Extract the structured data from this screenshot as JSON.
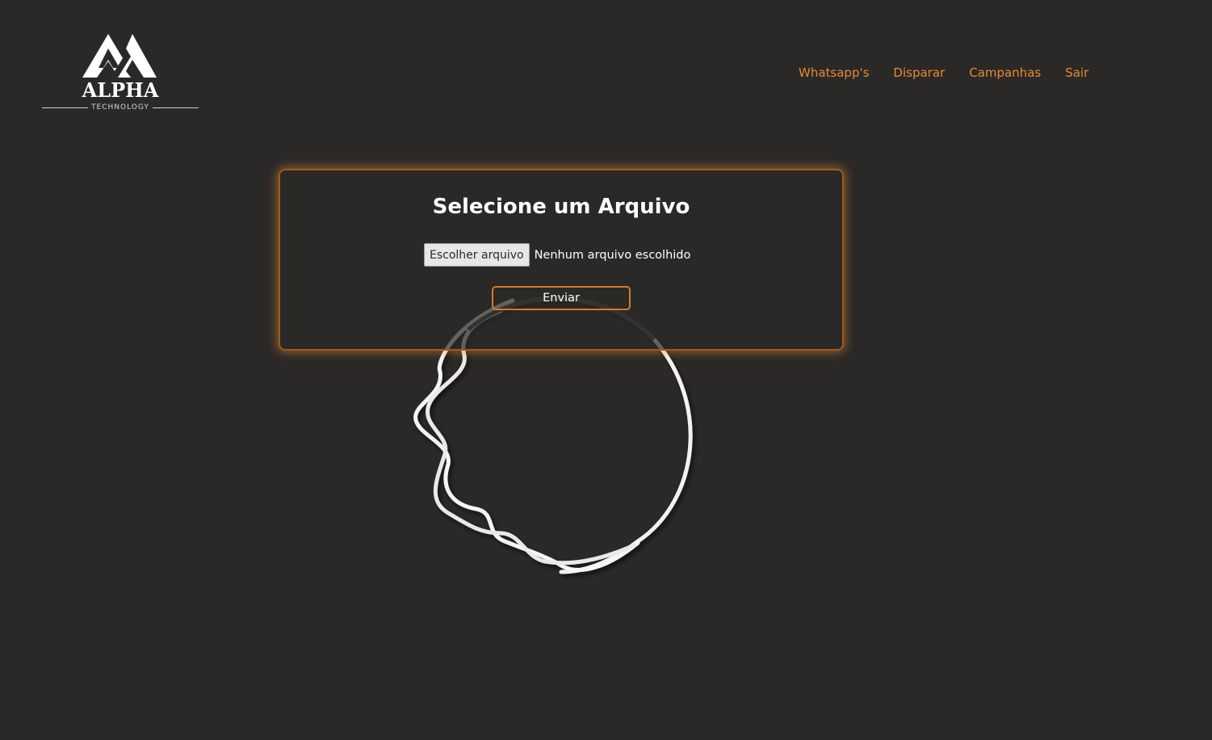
{
  "brand": {
    "name": "ALPHA",
    "tagline": "TECHNOLOGY"
  },
  "nav": {
    "items": [
      {
        "label": "Whatsapp's"
      },
      {
        "label": "Disparar"
      },
      {
        "label": "Campanhas"
      },
      {
        "label": "Sair"
      }
    ]
  },
  "upload": {
    "title": "Selecione um Arquivo",
    "choose_file_label": "Escolher arquivo",
    "file_status": "Nenhum arquivo escolhido",
    "submit_label": "Enviar"
  },
  "colors": {
    "background": "#2a2928",
    "accent": "#e88a2c",
    "text": "#ffffff"
  },
  "icons": {
    "logo": "alpha-mountain-logo",
    "loader": "wavy-ring-spinner"
  }
}
